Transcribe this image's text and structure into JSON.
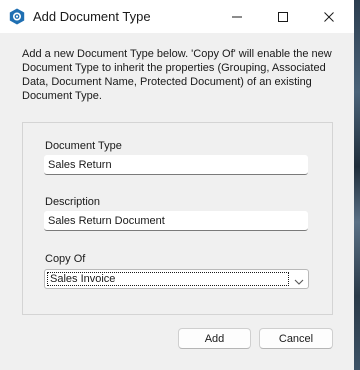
{
  "window": {
    "title": "Add Document Type"
  },
  "intro_text": "Add a new Document Type below. 'Copy Of' will enable the new Document Type to inherit the properties (Grouping, Associated Data, Document Name, Protected Document) of an existing Document Type.",
  "form": {
    "document_type": {
      "label": "Document Type",
      "value": "Sales Return"
    },
    "description": {
      "label": "Description",
      "value": "Sales Return Document"
    },
    "copy_of": {
      "label": "Copy Of",
      "selected": "Sales Invoice"
    }
  },
  "buttons": {
    "add_label": "Add",
    "cancel_label": "Cancel"
  },
  "colors": {
    "app_icon": "#1f6fb2",
    "window_bg": "#f0f0f0",
    "titlebar_bg": "#ffffff"
  },
  "icons": {
    "app": "app-hexagon-gear-icon",
    "minimize": "minimize-icon",
    "maximize": "maximize-icon",
    "close": "close-icon",
    "dropdown": "chevron-down-icon"
  }
}
